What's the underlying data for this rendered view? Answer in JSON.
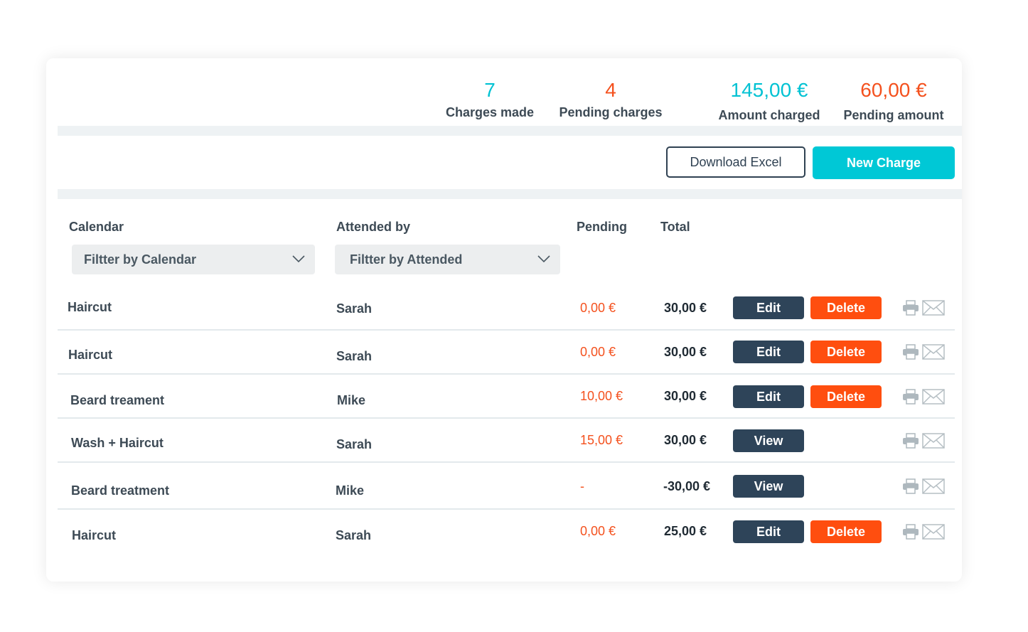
{
  "stats": {
    "charges_made": {
      "value": "7",
      "label": "Charges made"
    },
    "pending_charges": {
      "value": "4",
      "label": "Pending charges"
    },
    "amount_charged": {
      "value": "145,00 €",
      "label": "Amount charged"
    },
    "pending_amount": {
      "value": "60,00 €",
      "label": "Pending amount"
    }
  },
  "toolbar": {
    "download_label": "Download Excel",
    "new_charge_label": "New Charge"
  },
  "columns": {
    "calendar": "Calendar",
    "attended": "Attended by",
    "pending": "Pending",
    "total": "Total"
  },
  "filters": {
    "calendar_placeholder": "Filtter by Calendar",
    "attended_placeholder": "Filtter by Attended"
  },
  "actions": {
    "edit": "Edit",
    "delete": "Delete",
    "view": "View"
  },
  "icons": [
    "printer-icon",
    "envelope-icon",
    "chevron-down-icon"
  ],
  "colors": {
    "accent": "#00c8d6",
    "danger": "#ff4e0f",
    "dark": "#2e4459"
  },
  "rows": [
    {
      "service": "Haircut",
      "attended": "Sarah",
      "pending": "0,00 €",
      "total": "30,00 €"
    },
    {
      "service": "Haircut",
      "attended": "Sarah",
      "pending": "0,00 €",
      "total": "30,00 €"
    },
    {
      "service": "Beard treament",
      "attended": "Mike",
      "pending": "10,00 €",
      "total": "30,00 €"
    },
    {
      "service": "Wash + Haircut",
      "attended": "Sarah",
      "pending": "15,00 €",
      "total": "30,00 €"
    },
    {
      "service": "Beard treatment",
      "attended": "Mike",
      "pending": "-",
      "total": "-30,00 €"
    },
    {
      "service": "Haircut",
      "attended": "Sarah",
      "pending": "0,00 €",
      "total": "25,00 €"
    }
  ]
}
